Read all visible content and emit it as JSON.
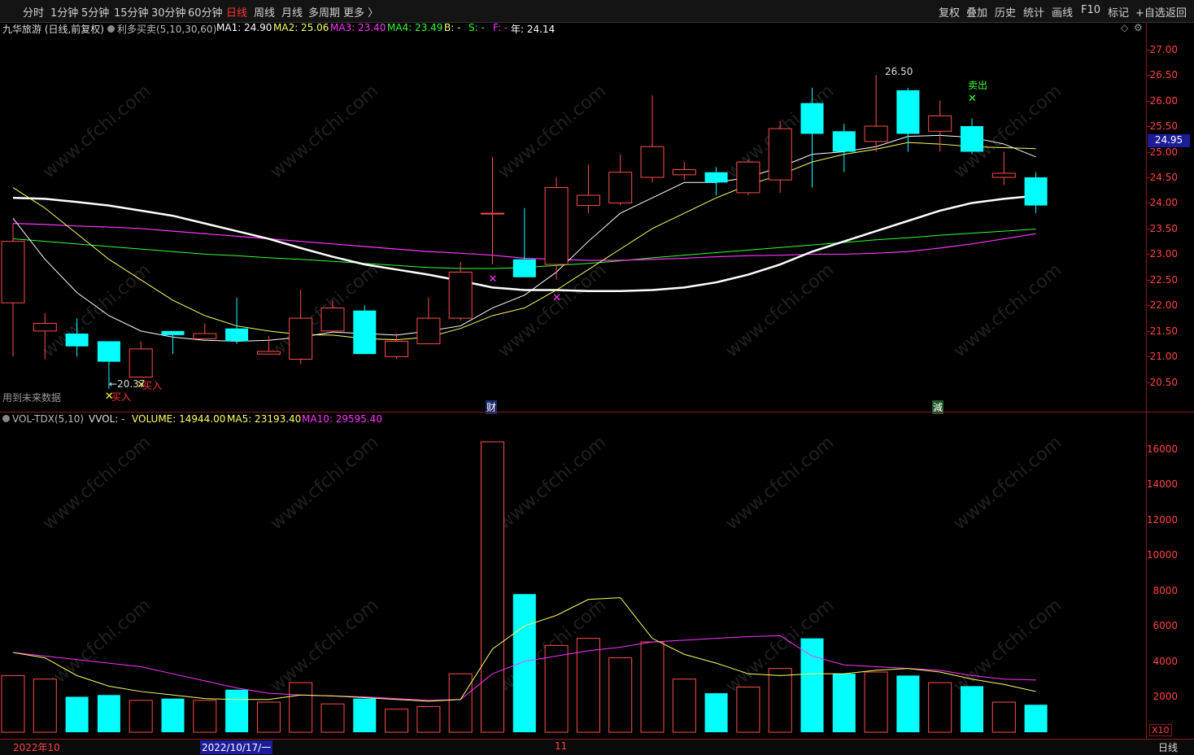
{
  "toolbar": {
    "left": [
      "分时",
      "1分钟",
      "5分钟",
      "15分钟",
      "30分钟",
      "60分钟",
      "日线",
      "周线",
      "月线",
      "多周期",
      "更多 〉"
    ],
    "active": "日线",
    "right": [
      "复权",
      "叠加",
      "历史",
      "统计",
      "画线",
      "F10",
      "标记",
      "+自选",
      "返回"
    ]
  },
  "main_header": {
    "stock": "九华旅游 (日线,前复权)",
    "indicator": "利多买卖(5,10,30,60)",
    "ma1": "MA1: 24.90",
    "ma2": "MA2: 25.06",
    "ma3": "MA3: 23.40",
    "ma4": "MA4: 23.49",
    "b": "B: -",
    "s": "S: -",
    "f": "F: -",
    "year": "年: 24.14"
  },
  "vol_header": {
    "name": "VOL-TDX(5,10)",
    "vvol": "VVOL: -",
    "volume": "VOLUME: 14944.00",
    "ma5": "MA5: 23193.40",
    "ma10": "MA10: 29595.40"
  },
  "annotations": {
    "future_data": "用到未来数据",
    "low_price": "←20.37",
    "high_price": "26.50",
    "buy": "买入",
    "sell": "卖出",
    "cai": "财",
    "jian": "減",
    "current_price": "24.95"
  },
  "price_axis": [
    "27.00",
    "26.50",
    "26.00",
    "25.50",
    "25.00",
    "24.50",
    "24.00",
    "23.50",
    "23.00",
    "22.50",
    "22.00",
    "21.50",
    "21.00",
    "20.50"
  ],
  "volume_axis": [
    "16000",
    "14000",
    "12000",
    "10000",
    "8000",
    "6000",
    "4000",
    "2000"
  ],
  "volume_unit": "X10",
  "bottom": {
    "date1": "2022年10",
    "date2": "2022/10/17/一",
    "date3": "11",
    "period": "日线"
  },
  "watermark": "www.cfchi.com",
  "colors": {
    "up": "#ff4d4d",
    "down": "#00ffff",
    "ma_white": "#ffffff",
    "ma_yellow": "#ffff66",
    "ma_magenta": "#ff33ff",
    "ma_green": "#33ff33",
    "thick_white": "#ffffff"
  },
  "chart_data": {
    "type": "candlestick",
    "price_range": [
      20.1,
      27.2
    ],
    "candles": [
      {
        "o": 22.05,
        "c": 23.25,
        "h": 23.6,
        "l": 21.0
      },
      {
        "o": 21.5,
        "c": 21.65,
        "h": 21.85,
        "l": 20.95
      },
      {
        "o": 21.45,
        "c": 21.2,
        "h": 21.75,
        "l": 21.0
      },
      {
        "o": 21.3,
        "c": 20.9,
        "h": 21.3,
        "l": 20.37
      },
      {
        "o": 20.6,
        "c": 21.15,
        "h": 21.3,
        "l": 20.6
      },
      {
        "o": 21.5,
        "c": 21.42,
        "h": 21.5,
        "l": 21.05
      },
      {
        "o": 21.35,
        "c": 21.45,
        "h": 21.65,
        "l": 21.35
      },
      {
        "o": 21.55,
        "c": 21.3,
        "h": 22.15,
        "l": 21.25
      },
      {
        "o": 21.05,
        "c": 21.1,
        "h": 21.4,
        "l": 21.05
      },
      {
        "o": 20.95,
        "c": 21.75,
        "h": 22.3,
        "l": 20.85
      },
      {
        "o": 21.5,
        "c": 21.95,
        "h": 22.1,
        "l": 21.5
      },
      {
        "o": 21.9,
        "c": 21.05,
        "h": 22.0,
        "l": 21.05
      },
      {
        "o": 21.0,
        "c": 21.3,
        "h": 21.45,
        "l": 20.95
      },
      {
        "o": 21.25,
        "c": 21.75,
        "h": 22.15,
        "l": 21.25
      },
      {
        "o": 21.75,
        "c": 22.65,
        "h": 22.85,
        "l": 21.7
      },
      {
        "o": 23.8,
        "c": 23.8,
        "h": 24.9,
        "l": 22.8
      },
      {
        "o": 22.9,
        "c": 22.55,
        "h": 23.9,
        "l": 22.55
      },
      {
        "o": 22.8,
        "c": 24.3,
        "h": 24.5,
        "l": 22.5
      },
      {
        "o": 23.95,
        "c": 24.15,
        "h": 24.75,
        "l": 23.8
      },
      {
        "o": 24.0,
        "c": 24.6,
        "h": 24.95,
        "l": 23.95
      },
      {
        "o": 24.5,
        "c": 25.1,
        "h": 26.1,
        "l": 24.4
      },
      {
        "o": 24.55,
        "c": 24.65,
        "h": 24.8,
        "l": 24.45
      },
      {
        "o": 24.6,
        "c": 24.4,
        "h": 24.7,
        "l": 24.15
      },
      {
        "o": 24.2,
        "c": 24.8,
        "h": 24.85,
        "l": 24.15
      },
      {
        "o": 24.45,
        "c": 25.45,
        "h": 25.6,
        "l": 24.2
      },
      {
        "o": 25.95,
        "c": 25.35,
        "h": 26.25,
        "l": 24.3
      },
      {
        "o": 25.4,
        "c": 25.0,
        "h": 25.55,
        "l": 24.6
      },
      {
        "o": 25.2,
        "c": 25.5,
        "h": 26.5,
        "l": 25.0
      },
      {
        "o": 26.2,
        "c": 25.35,
        "h": 26.25,
        "l": 25.0
      },
      {
        "o": 25.4,
        "c": 25.7,
        "h": 26.0,
        "l": 25.0
      },
      {
        "o": 25.5,
        "c": 25.0,
        "h": 25.65,
        "l": 24.95
      },
      {
        "o": 24.5,
        "c": 24.58,
        "h": 25.0,
        "l": 24.35
      },
      {
        "o": 24.5,
        "c": 23.95,
        "h": 24.6,
        "l": 23.8
      }
    ],
    "volumes": [
      3200,
      3000,
      2000,
      2100,
      1800,
      1900,
      1800,
      2400,
      1700,
      2800,
      1600,
      1900,
      1300,
      1450,
      3300,
      16400,
      7800,
      4900,
      5300,
      4200,
      5100,
      3000,
      2200,
      2550,
      3600,
      5300,
      3300,
      3400,
      3200,
      2800,
      2600,
      1700,
      1550
    ],
    "volume_range": [
      0,
      17000
    ],
    "ma_white_thin": [
      23.7,
      22.9,
      22.25,
      21.8,
      21.5,
      21.38,
      21.32,
      21.3,
      21.32,
      21.38,
      21.48,
      21.45,
      21.42,
      21.5,
      21.6,
      21.95,
      22.2,
      22.65,
      23.25,
      23.8,
      24.1,
      24.4,
      24.4,
      24.5,
      24.7,
      24.95,
      25.0,
      25.1,
      25.3,
      25.32,
      25.28,
      25.15,
      24.9
    ],
    "ma_yellow": [
      24.3,
      23.9,
      23.4,
      22.9,
      22.5,
      22.1,
      21.8,
      21.6,
      21.5,
      21.43,
      21.42,
      21.35,
      21.33,
      21.38,
      21.55,
      21.8,
      21.95,
      22.3,
      22.7,
      23.1,
      23.5,
      23.8,
      24.1,
      24.35,
      24.55,
      24.8,
      24.95,
      25.05,
      25.18,
      25.15,
      25.1,
      25.08,
      25.06
    ],
    "ma_magenta": [
      23.6,
      23.58,
      23.55,
      23.53,
      23.5,
      23.45,
      23.4,
      23.35,
      23.3,
      23.25,
      23.2,
      23.15,
      23.1,
      23.05,
      23.02,
      22.98,
      22.92,
      22.9,
      22.88,
      22.88,
      22.9,
      22.92,
      22.95,
      22.97,
      22.98,
      23.0,
      23.0,
      23.02,
      23.05,
      23.12,
      23.2,
      23.3,
      23.4
    ],
    "ma_green": [
      23.3,
      23.25,
      23.2,
      23.15,
      23.1,
      23.05,
      23.0,
      22.97,
      22.93,
      22.9,
      22.86,
      22.82,
      22.78,
      22.74,
      22.72,
      22.72,
      22.74,
      22.78,
      22.82,
      22.87,
      22.93,
      22.98,
      23.03,
      23.08,
      23.13,
      23.18,
      23.23,
      23.28,
      23.32,
      23.37,
      23.41,
      23.45,
      23.49
    ],
    "ma_thick_white": [
      24.1,
      24.08,
      24.02,
      23.95,
      23.85,
      23.75,
      23.6,
      23.45,
      23.3,
      23.12,
      22.95,
      22.8,
      22.7,
      22.6,
      22.48,
      22.35,
      22.3,
      22.3,
      22.28,
      22.28,
      22.3,
      22.35,
      22.45,
      22.6,
      22.8,
      23.05,
      23.25,
      23.45,
      23.65,
      23.85,
      24.0,
      24.08,
      24.14
    ],
    "vol_ma5": [
      4500,
      4200,
      3200,
      2600,
      2300,
      2100,
      1900,
      1850,
      1850,
      2100,
      2050,
      1950,
      1850,
      1750,
      1850,
      4700,
      6000,
      6600,
      7500,
      7600,
      5300,
      4400,
      3900,
      3300,
      3200,
      3300,
      3300,
      3500,
      3600,
      3400,
      3000,
      2700,
      2300
    ],
    "vol_ma10": [
      4500,
      4300,
      4100,
      3900,
      3700,
      3300,
      2900,
      2500,
      2200,
      2100,
      2050,
      2000,
      1900,
      1800,
      1850,
      3300,
      4000,
      4300,
      4600,
      4800,
      5100,
      5200,
      5300,
      5400,
      5450,
      4300,
      3800,
      3700,
      3600,
      3500,
      3200,
      3000,
      2950
    ]
  }
}
